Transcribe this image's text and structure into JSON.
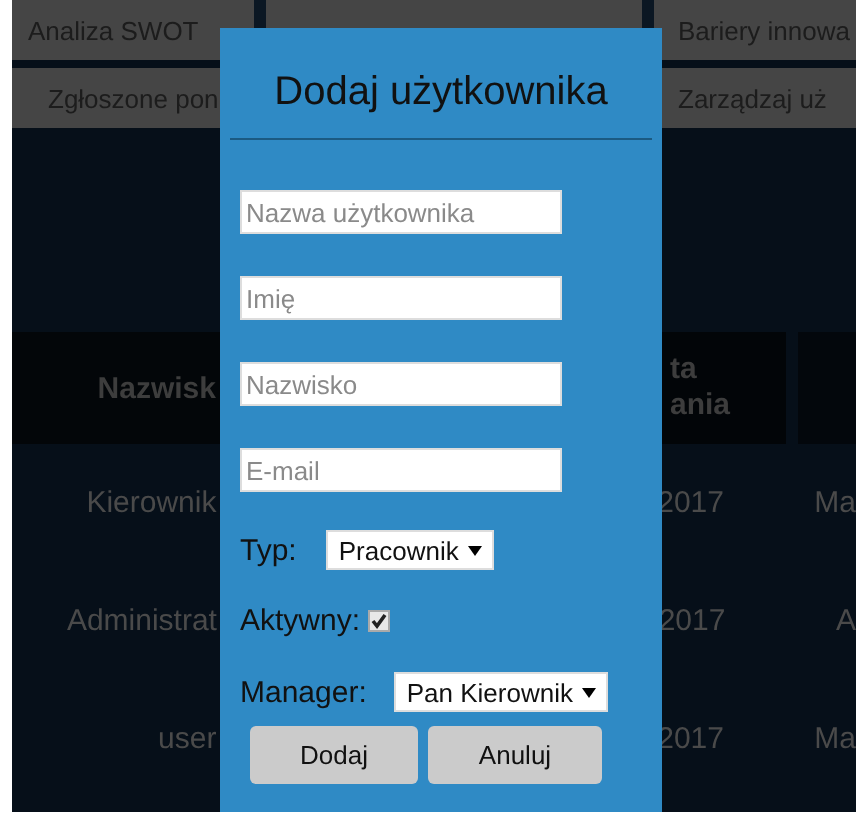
{
  "nav_rows": [
    {
      "left": "Analiza SWOT",
      "right": "Bariery innowa"
    },
    {
      "left": "Zgłoszone pon",
      "right": "Zarządzaj uż"
    }
  ],
  "table": {
    "header": {
      "column_1": "Nazwisk",
      "column_3": [
        "ta",
        "ania"
      ]
    },
    "rows": [
      {
        "column_1": "Kierownik",
        "column_3": "2017",
        "column_4": "Ma"
      },
      {
        "column_1": "Administrat",
        "column_3": "2017",
        "column_4": "A"
      },
      {
        "column_1": "user",
        "column_3": "2017",
        "column_4": "Ma"
      }
    ]
  },
  "dialog": {
    "title": "Dodaj użytkownika",
    "fields": [
      {
        "placeholder": "Nazwa użytkownika"
      },
      {
        "placeholder": "Imię"
      },
      {
        "placeholder": "Nazwisko"
      },
      {
        "placeholder": "E-mail"
      }
    ],
    "type": {
      "label": "Typ:",
      "value": "Pracownik"
    },
    "active": {
      "label": "Aktywny:",
      "checked": true
    },
    "manager": {
      "label": "Manager:",
      "value": "Pan Kierownik"
    },
    "buttons": [
      "Dodaj",
      "Anuluj"
    ]
  }
}
